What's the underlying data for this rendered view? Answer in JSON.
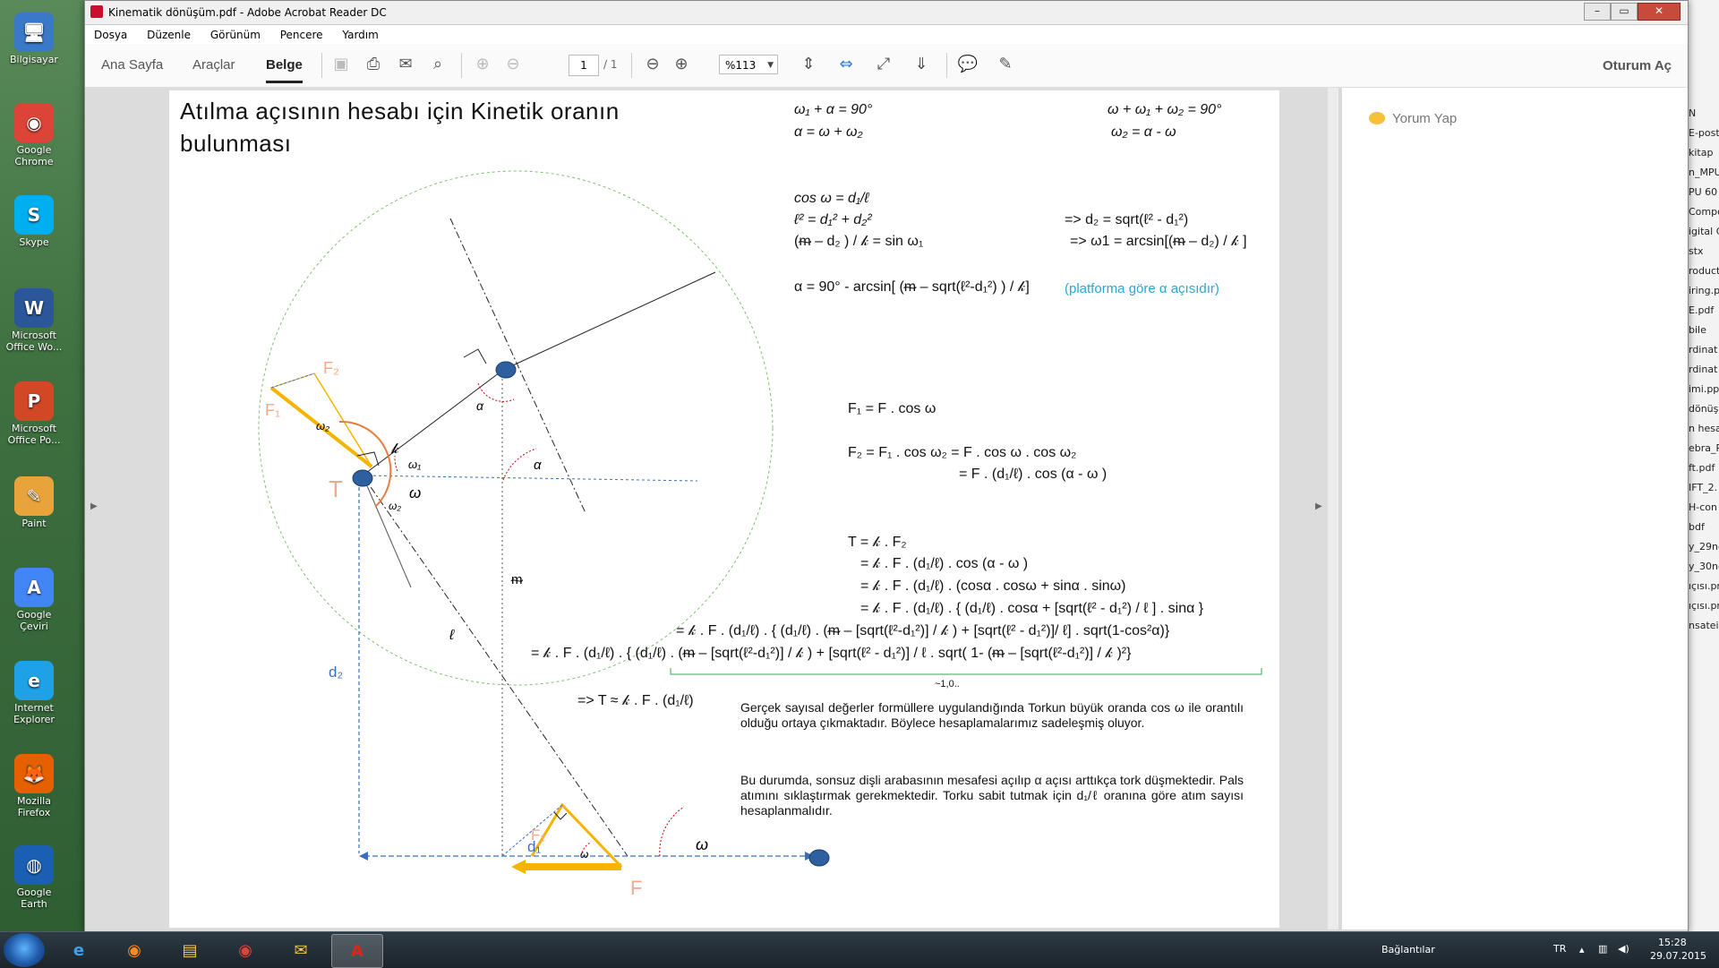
{
  "window": {
    "title": "Kinematik dönüşüm.pdf - Adobe Acrobat Reader DC",
    "min": "–",
    "max": "▭",
    "close": "✕"
  },
  "menu": [
    "Dosya",
    "Düzenle",
    "Görünüm",
    "Pencere",
    "Yardım"
  ],
  "toolbar": {
    "tabs": [
      "Ana Sayfa",
      "Araçlar",
      "Belge"
    ],
    "page_current": "1",
    "page_total": "/ 1",
    "zoom": "%113",
    "sign_in": "Oturum Aç"
  },
  "right_panel": {
    "comment": "Yorum Yap"
  },
  "desktop_icons": [
    {
      "label": "Bilgisayar",
      "color": "#3a78c8",
      "glyph": "🖥"
    },
    {
      "label": "Google Chrome",
      "color": "#db4437",
      "glyph": "◉"
    },
    {
      "label": "Skype",
      "color": "#00aff0",
      "glyph": "S"
    },
    {
      "label": "Microsoft Office Wo...",
      "color": "#2b579a",
      "glyph": "W"
    },
    {
      "label": "Microsoft Office Po...",
      "color": "#d24726",
      "glyph": "P"
    },
    {
      "label": "Paint",
      "color": "#e8a43a",
      "glyph": "✎"
    },
    {
      "label": "Google Çeviri",
      "color": "#4285f4",
      "glyph": "A"
    },
    {
      "label": "Internet Explorer",
      "color": "#1ea1e6",
      "glyph": "e"
    },
    {
      "label": "Mozilla Firefox",
      "color": "#e66000",
      "glyph": "🦊"
    },
    {
      "label": "Google Earth",
      "color": "#1a5fb4",
      "glyph": "◍"
    }
  ],
  "right_strip": [
    "N",
    "E-post",
    "kitap",
    "n_MPU",
    "PU 60",
    "Compo",
    "igital C",
    "stx",
    "roduct",
    "iring.p",
    "E.pdf",
    "bile",
    "rdinat",
    "rdinat",
    "imi.pp",
    "dönüş",
    "n hesa",
    "ebra_R",
    "ft.pdf",
    "IFT_2.",
    "H-con",
    "bdf",
    "y_29no",
    "y_30no",
    "ıçısı.pn",
    "ıçısı.pn",
    "nsatei"
  ],
  "document": {
    "heading_line1": "Atılma   açısının   hesabı   için   Kinetik   oranın",
    "heading_line2": "bulunması",
    "eq_a1": "ω₁  + α = 90°",
    "eq_a2": "α = ω  +  ω₂",
    "eq_b1": "ω  + ω₁  + ω₂  = 90°",
    "eq_b2": "ω₂  = α  - ω",
    "eq_c1": "cos ω   = d₁/ℓ",
    "eq_c2": "ℓ² = d₁² + d₂²",
    "eq_c2r": "=>     d₂  =  sqrt(ℓ² - d₁²)",
    "eq_c3": "(ᵯ – d₂ )  /  𝓀  = sin ω₁",
    "eq_c3r": "=>   ω1  =  arcsin[(ᵯ – d₂) / 𝓀 ]",
    "eq_d": "α = 90° - arcsin[ (ᵯ – sqrt(ℓ²-d₁²) ) / 𝓀]",
    "eq_d_note": "(platforma göre α açısıdır)",
    "f1": "F₁ = F . cos ω",
    "f2": "F₂ = F₁ . cos ω₂ = F . cos ω . cos ω₂",
    "f2b": "= F . (d₁/ℓ) . cos (α  - ω )",
    "t1": "T = 𝓀 . F₂",
    "t2": "= 𝓀 .  F . (d₁/ℓ) . cos (α  - ω )",
    "t3": "= 𝓀 .  F . (d₁/ℓ) . (cosα . cosω + sinα  . sinω)",
    "t4": "= 𝓀 .  F . (d₁/ℓ) .  { (d₁/ℓ) . cosα + [sqrt(ℓ² - d₁²) / ℓ ]  .  sinα }",
    "t5": "= 𝓀 .  F . (d₁/ℓ) .  { (d₁/ℓ) . (ᵯ – [sqrt(ℓ²-d₁²)] / 𝓀 ) + [sqrt(ℓ² - d₁²)]/ ℓ]  .  sqrt(1-cos²α)}",
    "t6": "= 𝓀 .  F . (d₁/ℓ) .  { (d₁/ℓ) . (ᵯ – [sqrt(ℓ²-d₁²)] / 𝓀 ) + [sqrt(ℓ² - d₁²)] / ℓ .  sqrt( 1- (ᵯ – [sqrt(ℓ²-d₁²)] / 𝓀 )²}",
    "approx_note": "~1,0..",
    "t_result": "=>    T ≈ 𝓀 .  F . (d₁/ℓ)",
    "para1": "Gerçek sayısal değerler formüllere uygulandığında Torkun büyük oranda cos ω ile orantılı olduğu ortaya çıkmaktadır.  Böylece hesaplamalarımız sadeleşmiş oluyor.",
    "para2": "Bu durumda, sonsuz dişli arabasının mesafesi açılıp α açısı arttıkça tork düşmektedir.  Pals atımını sıklaştırmak gerekmektedir. Torku sabit tutmak için d₁/ℓ oranına göre atım sayısı hesaplanmalıdır."
  },
  "diagram_labels": {
    "F2": "F₂",
    "F1": "F₁",
    "omega2": "ω₂",
    "T": "T",
    "k": "𝓀",
    "alpha": "α",
    "omega1": "ω₁",
    "omega": "ω",
    "m": "ᵯ",
    "l": "ℓ",
    "d2": "d₂",
    "d1": "d₁",
    "F": "F"
  },
  "taskbar": {
    "connections": "Bağlantılar",
    "lang": "TR",
    "time": "15:28",
    "date": "29.07.2015"
  }
}
